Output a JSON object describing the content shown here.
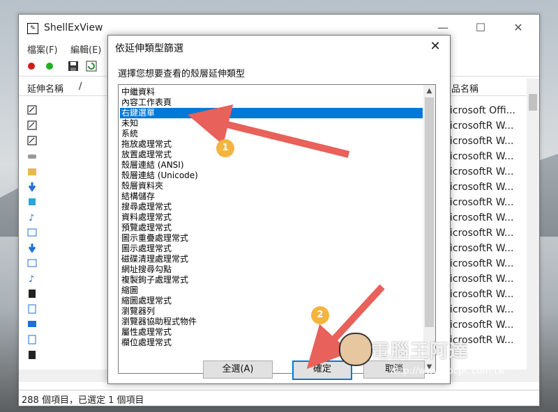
{
  "main_window": {
    "title": "ShellExView",
    "controls": {
      "minimize": "—",
      "maximize": "☐",
      "close": "✕"
    },
    "menu": [
      "檔案(F)",
      "編輯(E)"
    ],
    "columns": {
      "name": "延伸名稱",
      "sort_indicator": "/",
      "product": "品名稱"
    },
    "product_values": [
      "icrosoft Offi...",
      "icrosoftR W...",
      "icrosoftR W...",
      "icrosoftR W...",
      "icrosoftR W...",
      "icrosoftR W...",
      "icrosoftR W...",
      "icrosoftR W...",
      "icrosoftR W...",
      "icrosoftR W...",
      "icrosoftR W...",
      "icrosoftR W...",
      "icrosoftR W...",
      "icrosoftR W...",
      "icrosoftR W...",
      "icrosoftR W..."
    ],
    "status_text": "288 個項目，已選定 1 個項目"
  },
  "dialog": {
    "title": "依延伸類型篩選",
    "close": "✕",
    "prompt": "選擇您想要查看的殼層延伸類型",
    "items": [
      "中繼資料",
      "內容工作表頁",
      "右鍵選單",
      "未知",
      "系統",
      "拖放處理常式",
      "放置處理常式",
      "殼層連結 (ANSI)",
      "殼層連結 (Unicode)",
      "殼層資料夾",
      "結構儲存",
      "搜尋處理常式",
      "資料處理常式",
      "預覽處理常式",
      "圖示重疊處理常式",
      "圖示處理常式",
      "磁碟清理處理常式",
      "網址搜尋勾點",
      "複製鉤子處理常式",
      "縮圖",
      "縮圖處理常式",
      "瀏覽器列",
      "瀏覽器協助程式物件",
      "屬性處理常式",
      "欄位處理常式"
    ],
    "selected_index": 2,
    "buttons": {
      "select_all": "全選(A)",
      "ok": "確定",
      "cancel": "取消"
    }
  },
  "annotations": {
    "badge1": "1",
    "badge2": "2",
    "arrow_color": "#e8615a",
    "badge_color": "#f3b53f"
  },
  "watermark": {
    "title": "電腦王阿達",
    "url": "http://www.kocpc.com.tw"
  }
}
